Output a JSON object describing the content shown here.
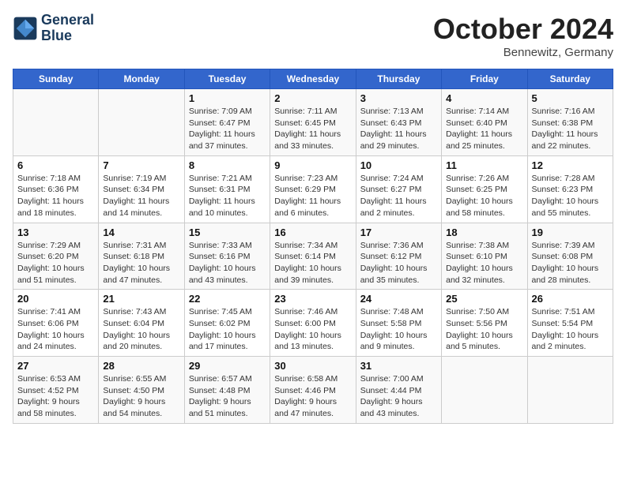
{
  "header": {
    "logo_line1": "General",
    "logo_line2": "Blue",
    "month": "October 2024",
    "location": "Bennewitz, Germany"
  },
  "weekdays": [
    "Sunday",
    "Monday",
    "Tuesday",
    "Wednesday",
    "Thursday",
    "Friday",
    "Saturday"
  ],
  "weeks": [
    [
      {
        "day": "",
        "content": ""
      },
      {
        "day": "",
        "content": ""
      },
      {
        "day": "1",
        "content": "Sunrise: 7:09 AM\nSunset: 6:47 PM\nDaylight: 11 hours\nand 37 minutes."
      },
      {
        "day": "2",
        "content": "Sunrise: 7:11 AM\nSunset: 6:45 PM\nDaylight: 11 hours\nand 33 minutes."
      },
      {
        "day": "3",
        "content": "Sunrise: 7:13 AM\nSunset: 6:43 PM\nDaylight: 11 hours\nand 29 minutes."
      },
      {
        "day": "4",
        "content": "Sunrise: 7:14 AM\nSunset: 6:40 PM\nDaylight: 11 hours\nand 25 minutes."
      },
      {
        "day": "5",
        "content": "Sunrise: 7:16 AM\nSunset: 6:38 PM\nDaylight: 11 hours\nand 22 minutes."
      }
    ],
    [
      {
        "day": "6",
        "content": "Sunrise: 7:18 AM\nSunset: 6:36 PM\nDaylight: 11 hours\nand 18 minutes."
      },
      {
        "day": "7",
        "content": "Sunrise: 7:19 AM\nSunset: 6:34 PM\nDaylight: 11 hours\nand 14 minutes."
      },
      {
        "day": "8",
        "content": "Sunrise: 7:21 AM\nSunset: 6:31 PM\nDaylight: 11 hours\nand 10 minutes."
      },
      {
        "day": "9",
        "content": "Sunrise: 7:23 AM\nSunset: 6:29 PM\nDaylight: 11 hours\nand 6 minutes."
      },
      {
        "day": "10",
        "content": "Sunrise: 7:24 AM\nSunset: 6:27 PM\nDaylight: 11 hours\nand 2 minutes."
      },
      {
        "day": "11",
        "content": "Sunrise: 7:26 AM\nSunset: 6:25 PM\nDaylight: 10 hours\nand 58 minutes."
      },
      {
        "day": "12",
        "content": "Sunrise: 7:28 AM\nSunset: 6:23 PM\nDaylight: 10 hours\nand 55 minutes."
      }
    ],
    [
      {
        "day": "13",
        "content": "Sunrise: 7:29 AM\nSunset: 6:20 PM\nDaylight: 10 hours\nand 51 minutes."
      },
      {
        "day": "14",
        "content": "Sunrise: 7:31 AM\nSunset: 6:18 PM\nDaylight: 10 hours\nand 47 minutes."
      },
      {
        "day": "15",
        "content": "Sunrise: 7:33 AM\nSunset: 6:16 PM\nDaylight: 10 hours\nand 43 minutes."
      },
      {
        "day": "16",
        "content": "Sunrise: 7:34 AM\nSunset: 6:14 PM\nDaylight: 10 hours\nand 39 minutes."
      },
      {
        "day": "17",
        "content": "Sunrise: 7:36 AM\nSunset: 6:12 PM\nDaylight: 10 hours\nand 35 minutes."
      },
      {
        "day": "18",
        "content": "Sunrise: 7:38 AM\nSunset: 6:10 PM\nDaylight: 10 hours\nand 32 minutes."
      },
      {
        "day": "19",
        "content": "Sunrise: 7:39 AM\nSunset: 6:08 PM\nDaylight: 10 hours\nand 28 minutes."
      }
    ],
    [
      {
        "day": "20",
        "content": "Sunrise: 7:41 AM\nSunset: 6:06 PM\nDaylight: 10 hours\nand 24 minutes."
      },
      {
        "day": "21",
        "content": "Sunrise: 7:43 AM\nSunset: 6:04 PM\nDaylight: 10 hours\nand 20 minutes."
      },
      {
        "day": "22",
        "content": "Sunrise: 7:45 AM\nSunset: 6:02 PM\nDaylight: 10 hours\nand 17 minutes."
      },
      {
        "day": "23",
        "content": "Sunrise: 7:46 AM\nSunset: 6:00 PM\nDaylight: 10 hours\nand 13 minutes."
      },
      {
        "day": "24",
        "content": "Sunrise: 7:48 AM\nSunset: 5:58 PM\nDaylight: 10 hours\nand 9 minutes."
      },
      {
        "day": "25",
        "content": "Sunrise: 7:50 AM\nSunset: 5:56 PM\nDaylight: 10 hours\nand 5 minutes."
      },
      {
        "day": "26",
        "content": "Sunrise: 7:51 AM\nSunset: 5:54 PM\nDaylight: 10 hours\nand 2 minutes."
      }
    ],
    [
      {
        "day": "27",
        "content": "Sunrise: 6:53 AM\nSunset: 4:52 PM\nDaylight: 9 hours\nand 58 minutes."
      },
      {
        "day": "28",
        "content": "Sunrise: 6:55 AM\nSunset: 4:50 PM\nDaylight: 9 hours\nand 54 minutes."
      },
      {
        "day": "29",
        "content": "Sunrise: 6:57 AM\nSunset: 4:48 PM\nDaylight: 9 hours\nand 51 minutes."
      },
      {
        "day": "30",
        "content": "Sunrise: 6:58 AM\nSunset: 4:46 PM\nDaylight: 9 hours\nand 47 minutes."
      },
      {
        "day": "31",
        "content": "Sunrise: 7:00 AM\nSunset: 4:44 PM\nDaylight: 9 hours\nand 43 minutes."
      },
      {
        "day": "",
        "content": ""
      },
      {
        "day": "",
        "content": ""
      }
    ]
  ]
}
